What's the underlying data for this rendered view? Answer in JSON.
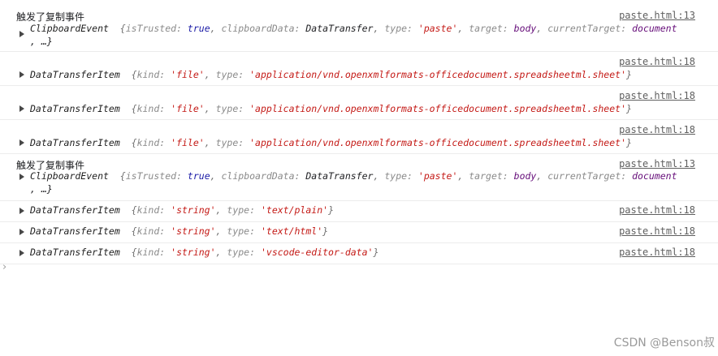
{
  "messages": [
    {
      "text": "触发了复制事件",
      "source": "paste.html:13"
    },
    {
      "text": "触发了复制事件",
      "source": "paste.html:13"
    }
  ],
  "clipboard_event": {
    "class": "ClipboardEvent",
    "isTrusted_key": "isTrusted:",
    "isTrusted_val": "true",
    "clipboardData_key": "clipboardData:",
    "clipboardData_val": "DataTransfer",
    "type_key": "type:",
    "type_val": "'paste'",
    "target_key": "target:",
    "target_val": "body",
    "currentTarget_key": "currentTarget:",
    "currentTarget_val": "document",
    "more": ", …}"
  },
  "items": [
    {
      "class": "DataTransferItem",
      "kind": "'file'",
      "type": "'application/vnd.openxmlformats-officedocument.spreadsheetml.sheet'",
      "source": "paste.html:18"
    },
    {
      "class": "DataTransferItem",
      "kind": "'file'",
      "type": "'application/vnd.openxmlformats-officedocument.spreadsheetml.sheet'",
      "source": "paste.html:18"
    },
    {
      "class": "DataTransferItem",
      "kind": "'file'",
      "type": "'application/vnd.openxmlformats-officedocument.spreadsheetml.sheet'",
      "source": "paste.html:18"
    },
    {
      "class": "DataTransferItem",
      "kind": "'string'",
      "type": "'text/plain'",
      "source": "paste.html:18"
    },
    {
      "class": "DataTransferItem",
      "kind": "'string'",
      "type": "'text/html'",
      "source": "paste.html:18"
    },
    {
      "class": "DataTransferItem",
      "kind": "'string'",
      "type": "'vscode-editor-data'",
      "source": "paste.html:18"
    }
  ],
  "labels": {
    "kind_key": "kind:",
    "type_key": "type:",
    "open_brace": "{",
    "close_brace": "}",
    "comma": ","
  },
  "prompt_symbol": "›",
  "watermark": "CSDN @Benson叔"
}
